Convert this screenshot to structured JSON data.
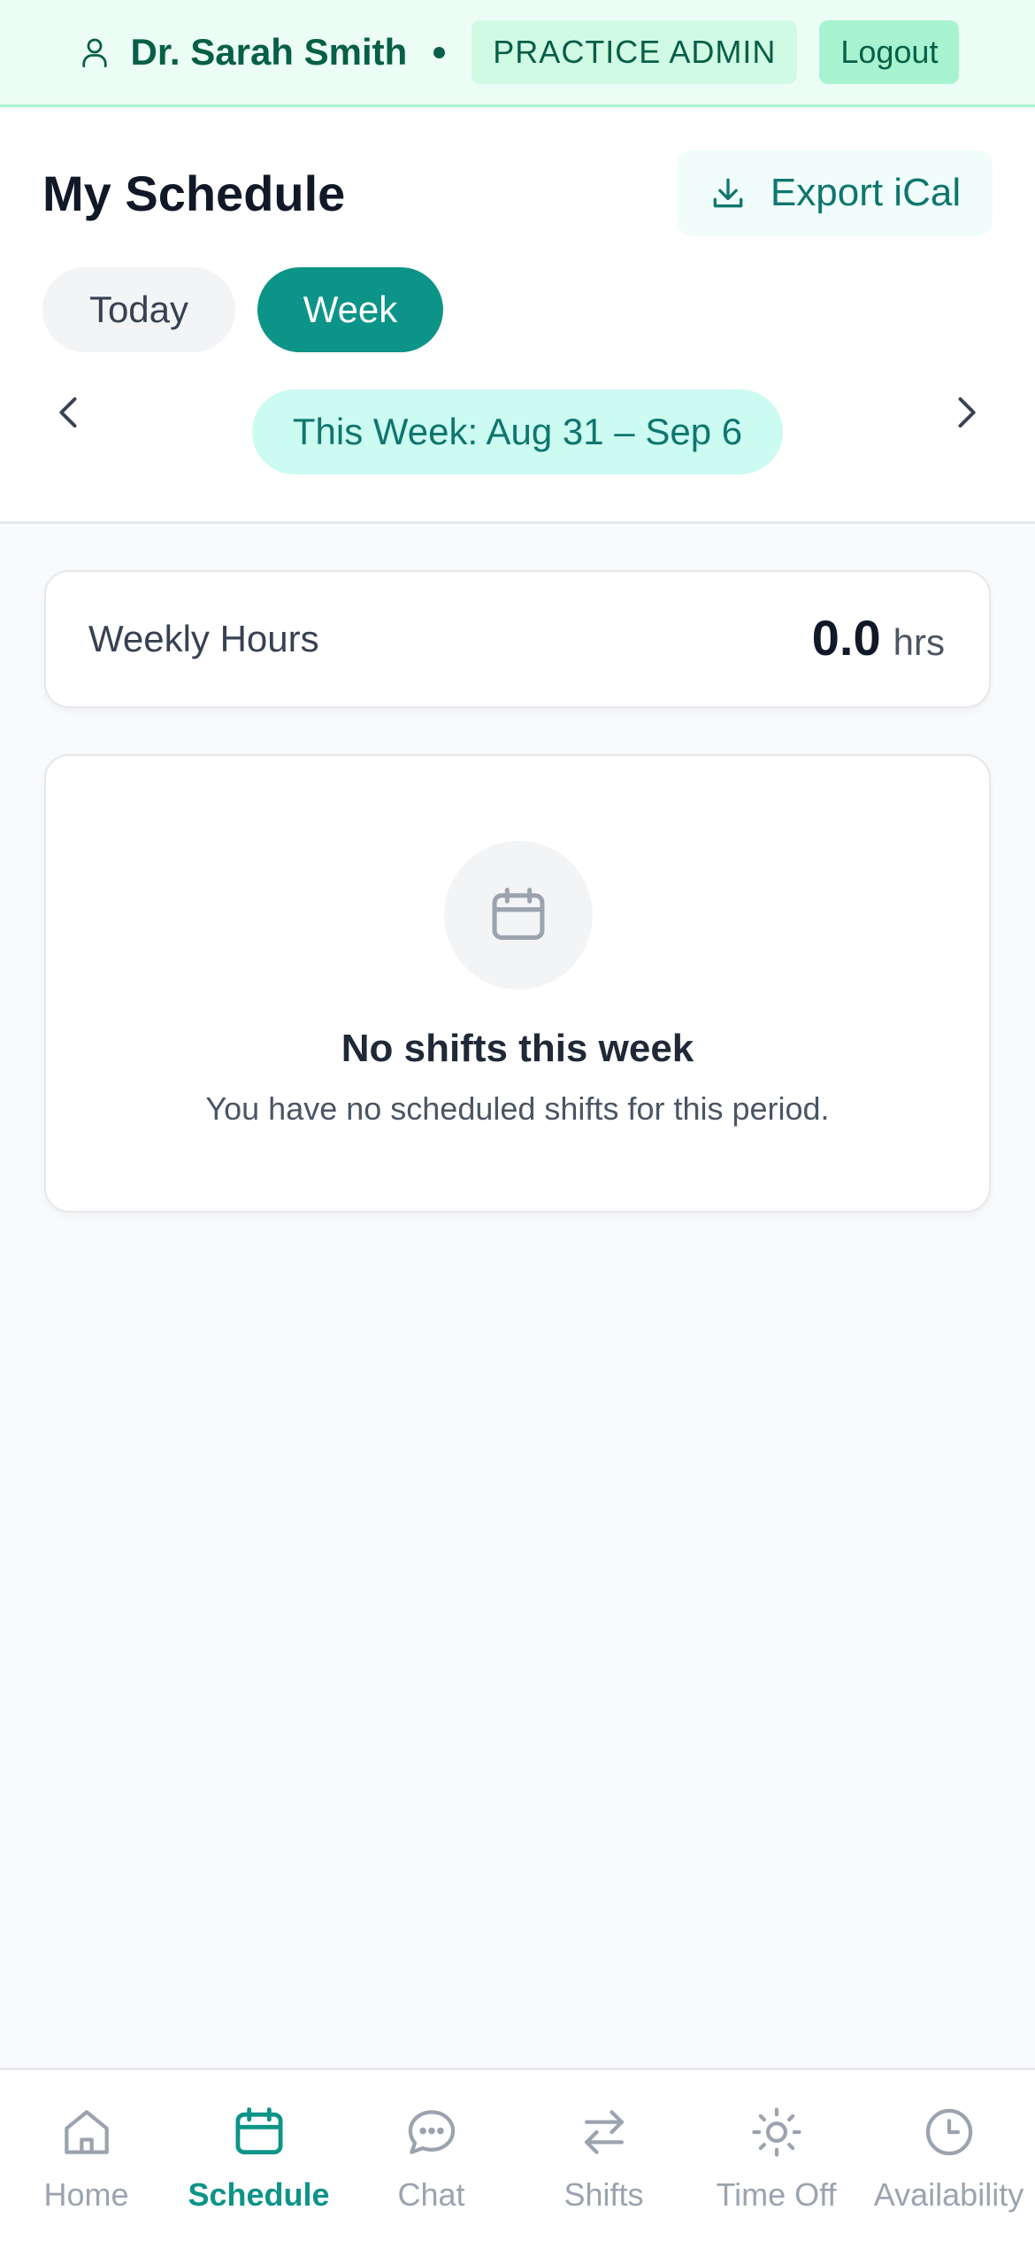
{
  "topbar": {
    "user_icon": "user-icon",
    "user_name": "Dr. Sarah Smith",
    "role": "PRACTICE ADMIN",
    "logout_label": "Logout"
  },
  "header": {
    "title": "My Schedule",
    "export_label": "Export iCal",
    "export_icon": "download-icon",
    "view_tabs": [
      {
        "label": "Today",
        "active": false
      },
      {
        "label": "Week",
        "active": true
      }
    ],
    "week_range": "This Week: Aug 31 – Sep 6"
  },
  "summary": {
    "label": "Weekly Hours",
    "value": "0.0",
    "unit": "hrs"
  },
  "empty_state": {
    "icon": "calendar-icon",
    "title": "No shifts this week",
    "subtitle": "You have no scheduled shifts for this period."
  },
  "bottom_nav": [
    {
      "label": "Home",
      "icon": "home-icon",
      "active": false
    },
    {
      "label": "Schedule",
      "icon": "calendar-icon",
      "active": true
    },
    {
      "label": "Chat",
      "icon": "chat-icon",
      "active": false
    },
    {
      "label": "Shifts",
      "icon": "swap-icon",
      "active": false
    },
    {
      "label": "Time Off",
      "icon": "sun-icon",
      "active": false
    },
    {
      "label": "Availability",
      "icon": "clock-icon",
      "active": false
    }
  ],
  "colors": {
    "accent": "#0d9488",
    "topbar_bg": "#ecfdf5",
    "text_dark": "#111827"
  }
}
